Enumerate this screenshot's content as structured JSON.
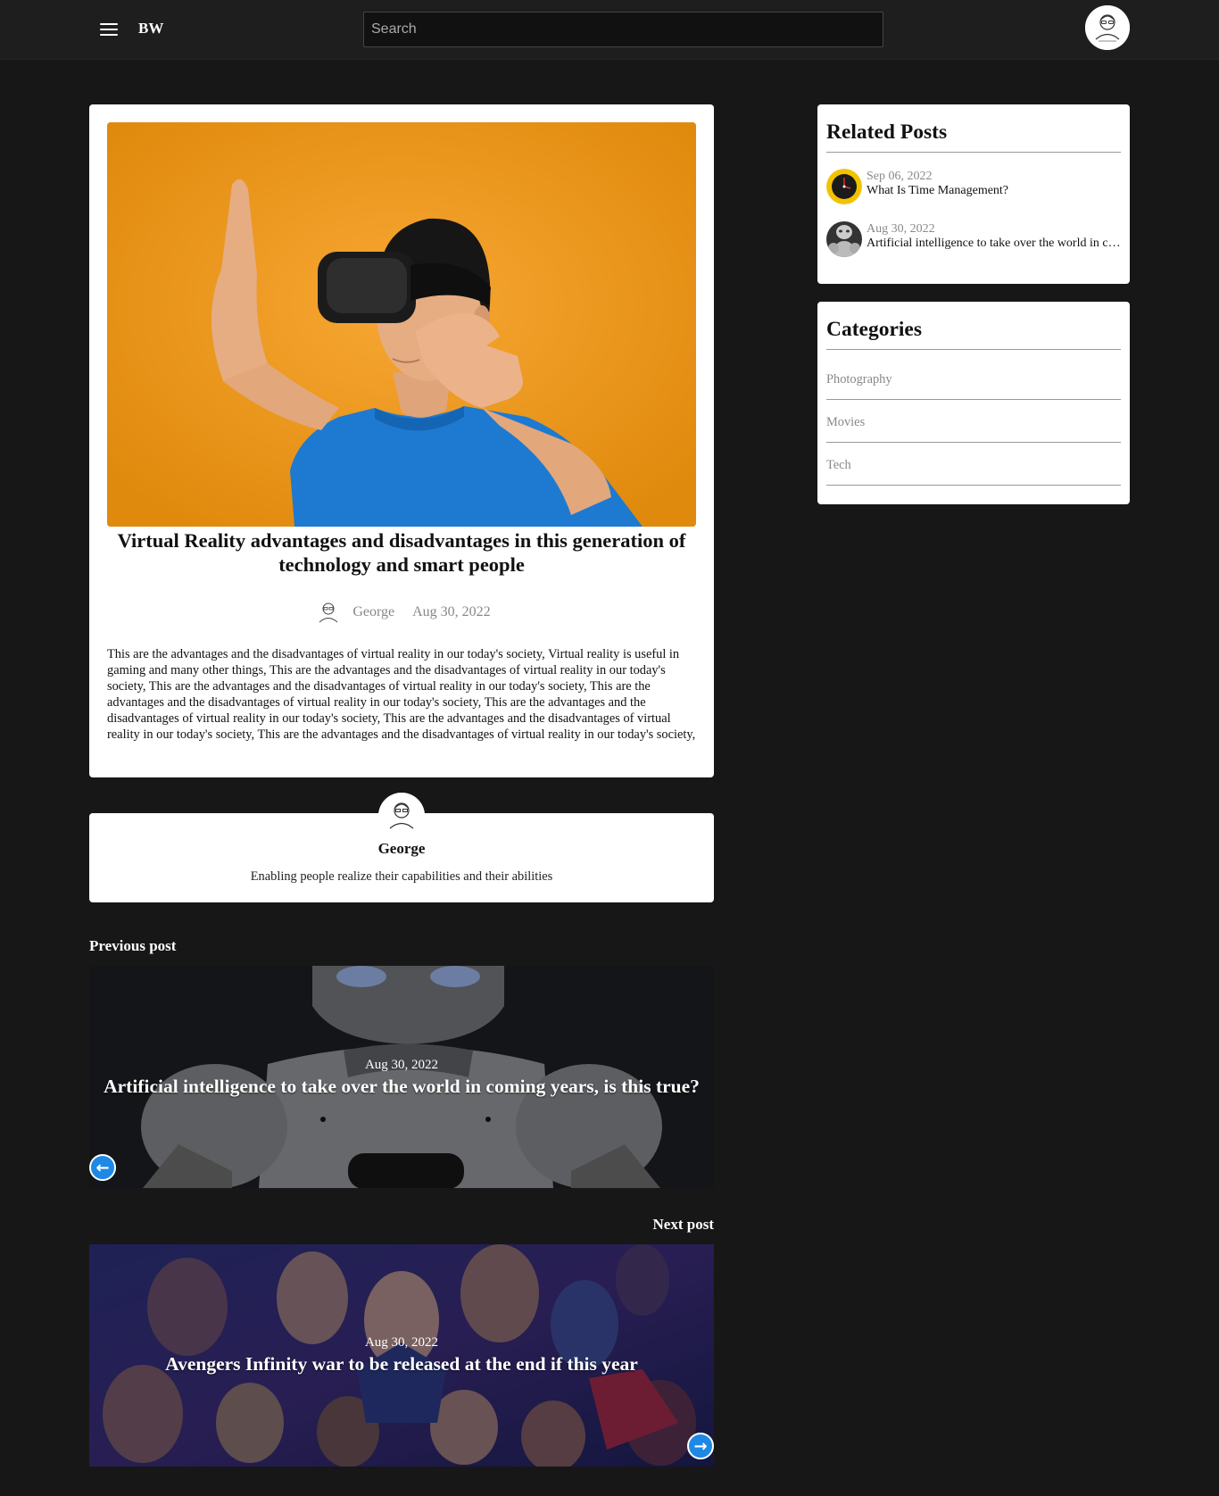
{
  "header": {
    "brand": "BW",
    "search_placeholder": "Search"
  },
  "post": {
    "title": "Virtual Reality advantages and disadvantages in this generation of technology and smart people",
    "author": "George",
    "date": "Aug 30, 2022",
    "body": "This are the advantages and the disadvantages of virtual reality in our today's society, Virtual reality is useful in gaming and many other things, This are the advantages and the disadvantages of virtual reality in our today's society, This are the advantages and the disadvantages of virtual reality in our today's society, This are the advantages and the disadvantages of virtual reality in our today's society, This are the advantages and the disadvantages of virtual reality in our today's society, This are the advantages and the disadvantages of virtual reality in our today's society, This are the advantages and the disadvantages of virtual reality in our today's society,"
  },
  "author_card": {
    "name": "George",
    "bio": "Enabling people realize their capabilities and their abilities"
  },
  "previous_post": {
    "label": "Previous post",
    "date": "Aug 30, 2022",
    "title": "Artificial intelligence to take over the world in coming years, is this true?",
    "arrow_icon": "arrow-left-icon"
  },
  "next_post": {
    "label": "Next post",
    "date": "Aug 30, 2022",
    "title": "Avengers Infinity war to be released at the end if this year",
    "arrow_icon": "arrow-right-icon"
  },
  "related_posts": {
    "title": "Related Posts",
    "items": [
      {
        "date": "Sep 06, 2022",
        "title": "What Is Time Management?"
      },
      {
        "date": "Aug 30, 2022",
        "title": "Artificial intelligence to take over the world in coming years, is this true?"
      }
    ]
  },
  "categories": {
    "title": "Categories",
    "items": [
      "Photography",
      "Movies",
      "Tech"
    ]
  },
  "colors": {
    "page_bg": "#171717",
    "topbar_bg": "#1e1e1e",
    "card_bg": "#ffffff",
    "accent_arrow": "#1e88e5",
    "hero_bg": "#f09a1f"
  }
}
